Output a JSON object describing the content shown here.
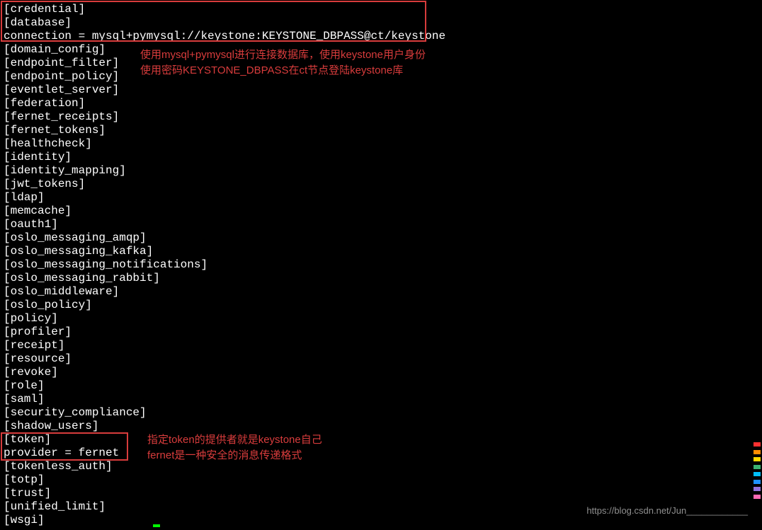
{
  "lines": {
    "l0": "[credential]",
    "l1": "[database]",
    "l2": "connection = mysql+pymysql://keystone:KEYSTONE_DBPASS@ct/keystone",
    "l3": "[domain_config]",
    "l4": "[endpoint_filter]",
    "l5": "[endpoint_policy]",
    "l6": "[eventlet_server]",
    "l7": "[federation]",
    "l8": "[fernet_receipts]",
    "l9": "[fernet_tokens]",
    "l10": "[healthcheck]",
    "l11": "[identity]",
    "l12": "[identity_mapping]",
    "l13": "[jwt_tokens]",
    "l14": "[ldap]",
    "l15": "[memcache]",
    "l16": "[oauth1]",
    "l17": "[oslo_messaging_amqp]",
    "l18": "[oslo_messaging_kafka]",
    "l19": "[oslo_messaging_notifications]",
    "l20": "[oslo_messaging_rabbit]",
    "l21": "[oslo_middleware]",
    "l22": "[oslo_policy]",
    "l23": "[policy]",
    "l24": "[profiler]",
    "l25": "[receipt]",
    "l26": "[resource]",
    "l27": "[revoke]",
    "l28": "[role]",
    "l29": "[saml]",
    "l30": "[security_compliance]",
    "l31": "[shadow_users]",
    "l32": "[token]",
    "l33": "provider = fernet",
    "l34": "[tokenless_auth]",
    "l35": "[totp]",
    "l36": "[trust]",
    "l37": "[unified_limit]",
    "l38": "[wsgi]"
  },
  "annotations": {
    "top_line1": "使用mysql+pymysql进行连接数据库，使用keystone用户身份",
    "top_line2": "使用密码KEYSTONE_DBPASS在ct节点登陆keystone库",
    "bottom_line1": "指定token的提供者就是keystone自己",
    "bottom_line2": "fernet是一种安全的消息传递格式"
  },
  "watermark": "https://blog.csdn.net/Jun____________",
  "scrollbar_colors": [
    "#ff3030",
    "#ff8c00",
    "#ffd700",
    "#3cb371",
    "#00bfff",
    "#1e90ff",
    "#9370db",
    "#ff69b4"
  ]
}
